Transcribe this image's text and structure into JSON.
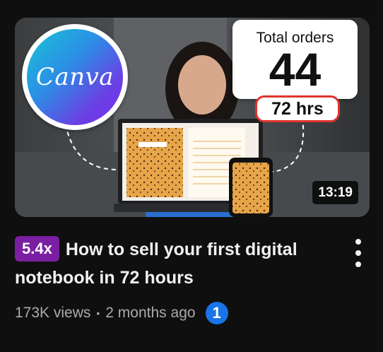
{
  "thumbnail": {
    "logo_text": "Canva",
    "orders_title": "Total orders",
    "orders_value": "44",
    "hours_label": "72 hrs",
    "duration": "13:19"
  },
  "video": {
    "speed_badge": "5.4x",
    "title": "How to sell your first digital notebook in 72 hours",
    "views": "173K views",
    "separator": "•",
    "age": "2 months ago",
    "info_icon_text": "1"
  },
  "icons": {
    "more": "more-vertical-icon",
    "info": "number-one-icon"
  },
  "colors": {
    "background": "#0f0f0f",
    "badge": "#7b1fa2",
    "accent_red": "#e0332b",
    "info_blue": "#1a73e8"
  }
}
